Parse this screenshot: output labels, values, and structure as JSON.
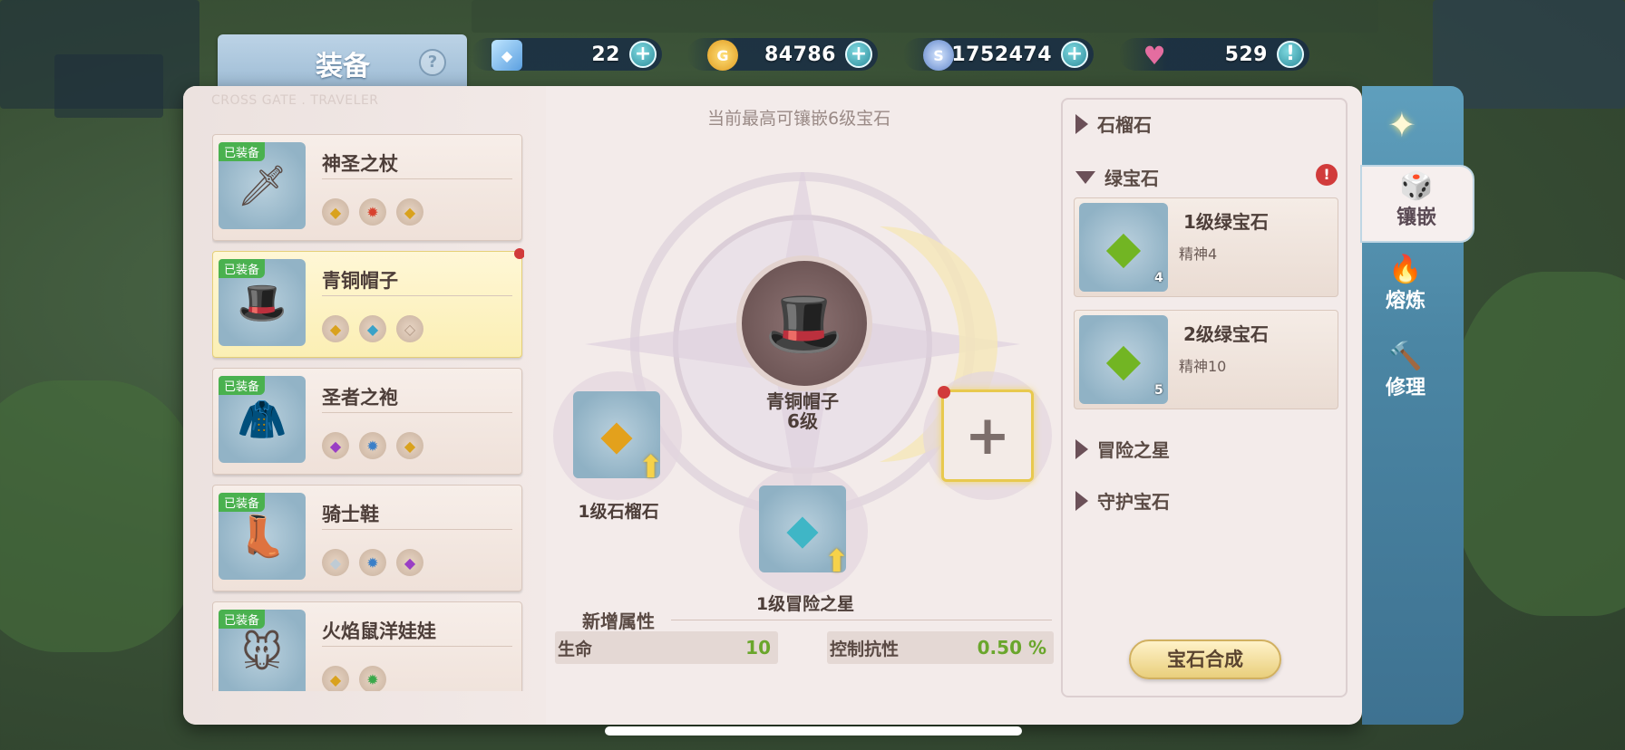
{
  "header": {
    "title": "装备",
    "help_icon": "?",
    "subtitle_en": "CROSS GATE . TRAVELER"
  },
  "currencies": [
    {
      "name": "crystal",
      "icon": "cube-gem-icon",
      "value": "22"
    },
    {
      "name": "gold",
      "icon": "gold-coin-icon",
      "value": "84786"
    },
    {
      "name": "silver",
      "icon": "silver-coin-icon",
      "value": "1752474"
    },
    {
      "name": "stamina",
      "icon": "heart-icon",
      "value": "529"
    }
  ],
  "equipment": [
    {
      "badge": "已装备",
      "name": "神圣之杖",
      "icon": "🗡",
      "gems": [
        "◆",
        "✹",
        "◆"
      ],
      "selected": false,
      "alert": false
    },
    {
      "badge": "已装备",
      "name": "青铜帽子",
      "icon": "🎩",
      "gems": [
        "◆",
        "◆",
        "◇"
      ],
      "selected": true,
      "alert": true
    },
    {
      "badge": "已装备",
      "name": "圣者之袍",
      "icon": "🧥",
      "gems": [
        "◆",
        "✹",
        "◆"
      ],
      "selected": false,
      "alert": false
    },
    {
      "badge": "已装备",
      "name": "骑士鞋",
      "icon": "👢",
      "gems": [
        "◆",
        "✹",
        "◆"
      ],
      "selected": false,
      "alert": false
    },
    {
      "badge": "已装备",
      "name": "火焰鼠洋娃娃",
      "icon": "🐭",
      "gems": [
        "◆",
        "✹"
      ],
      "selected": false,
      "alert": false
    }
  ],
  "center": {
    "hint": "当前最高可镶嵌6级宝石",
    "item_name": "青铜帽子",
    "item_level": "6级",
    "slots": [
      {
        "label": "1级石榴石",
        "icon": "◆"
      },
      {
        "label": "1级冒险之星",
        "icon": "◆"
      }
    ],
    "empty_slot_icon": "+"
  },
  "stats": {
    "title": "新增属性",
    "items": [
      {
        "key": "生命",
        "value": "10"
      },
      {
        "key": "控制抗性",
        "value": "0.50 %"
      }
    ]
  },
  "gem_categories": [
    {
      "name": "石榴石",
      "expanded": false
    },
    {
      "name": "绿宝石",
      "expanded": true,
      "alert": "!"
    },
    {
      "name": "冒险之星",
      "expanded": false
    },
    {
      "name": "守护宝石",
      "expanded": false
    }
  ],
  "gems": [
    {
      "name": "1级绿宝石",
      "stat": "精神4",
      "count": "4"
    },
    {
      "name": "2级绿宝石",
      "stat": "精神10",
      "count": "5"
    }
  ],
  "synth_button": "宝石合成",
  "tabs": [
    {
      "label": "镶嵌",
      "icon": "🎲",
      "active": true
    },
    {
      "label": "熔炼",
      "icon": "🔥",
      "active": false
    },
    {
      "label": "修理",
      "icon": "🔨",
      "active": false
    }
  ],
  "colors": {
    "panel_bg": "#f3ebea",
    "accent_green": "#6aa62c",
    "badge_green": "#4ab14f",
    "alert_red": "#d13b3b",
    "side_blue": "#4b86a4"
  }
}
